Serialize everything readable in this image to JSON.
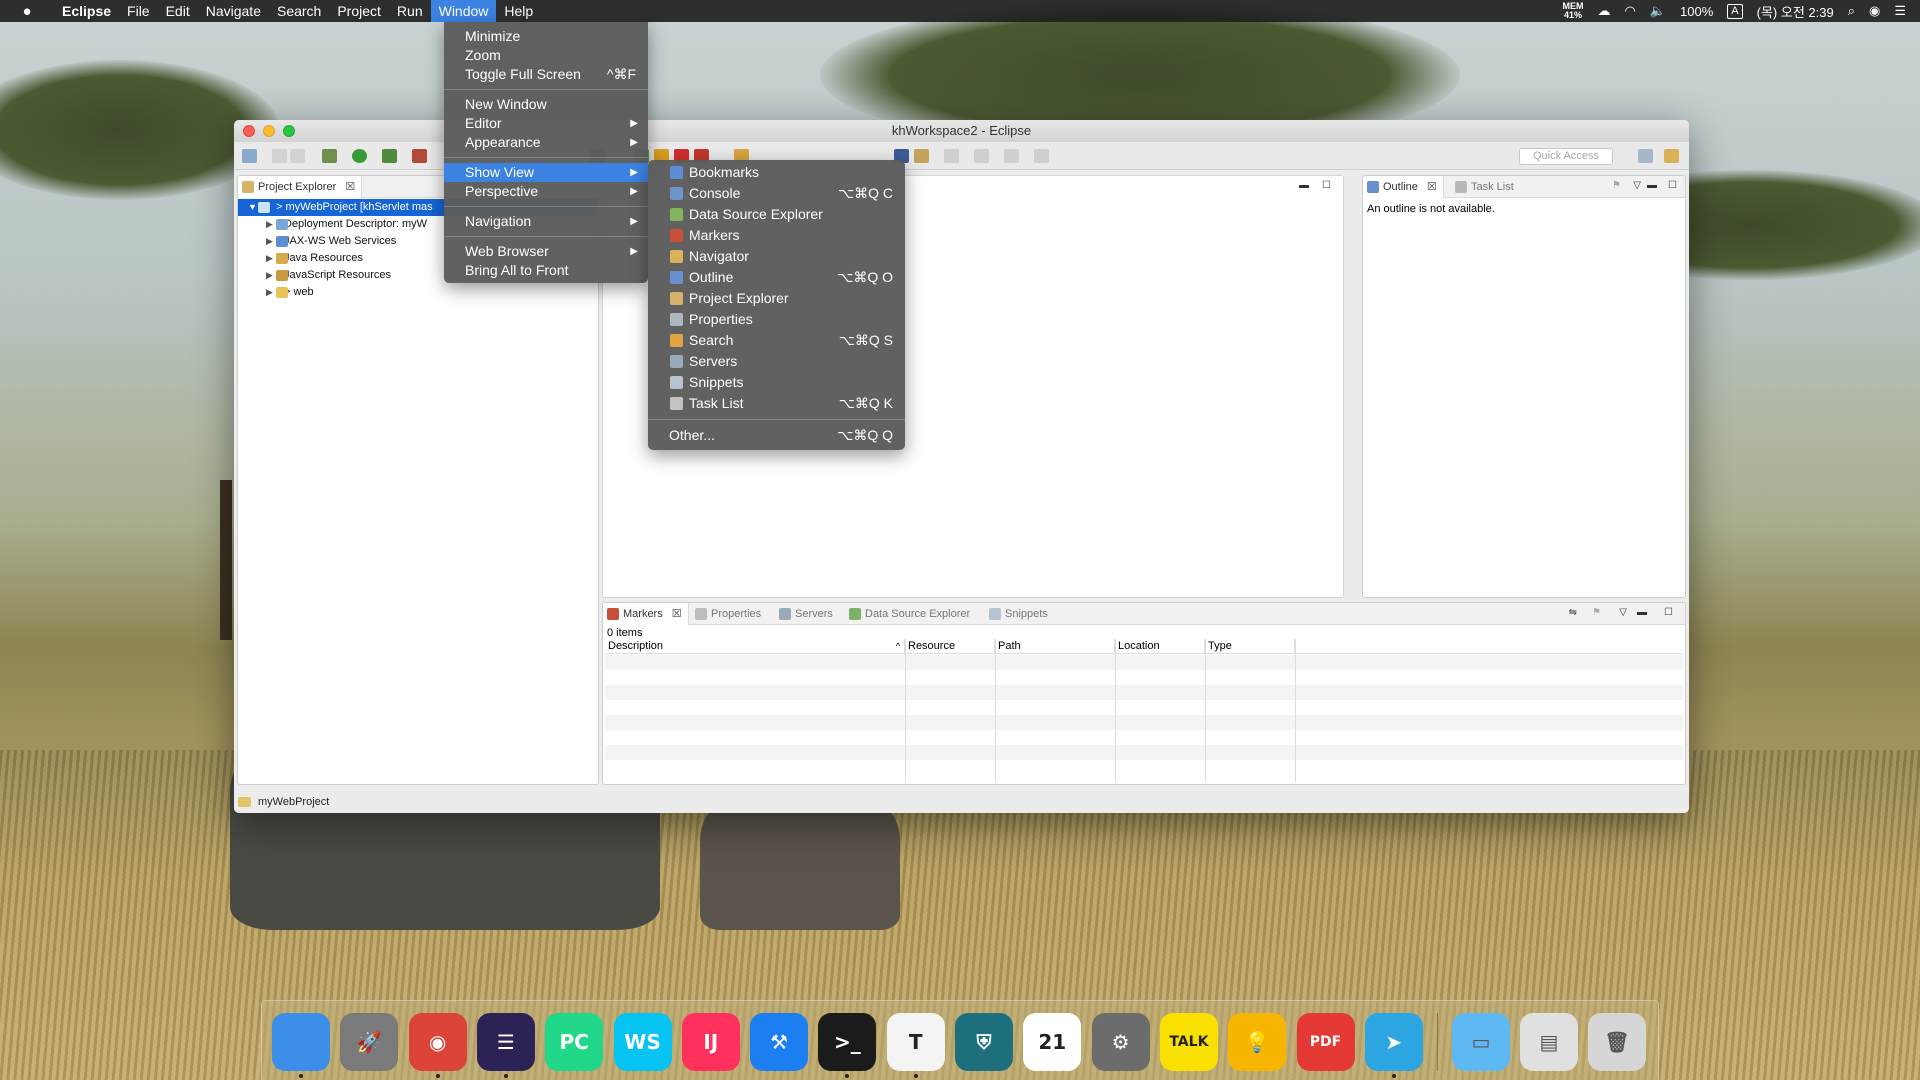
{
  "menubar": {
    "app": "Eclipse",
    "items": [
      "File",
      "Edit",
      "Navigate",
      "Search",
      "Project",
      "Run",
      "Window",
      "Help"
    ],
    "active": "Window",
    "status": {
      "mem_label": "MEM",
      "mem_value": "41%",
      "battery": "100%",
      "input": "A",
      "clock": "(목) 오전 2:39"
    }
  },
  "window": {
    "title": "khWorkspace2 - Eclipse",
    "quick_access_placeholder": "Quick Access",
    "status_text": "myWebProject"
  },
  "project_explorer": {
    "tab": "Project Explorer",
    "items": [
      {
        "label": "> myWebProject [khServlet mas",
        "selected": true
      },
      {
        "label": "Deployment Descriptor: myW"
      },
      {
        "label": "JAX-WS Web Services"
      },
      {
        "label": "Java Resources"
      },
      {
        "label": "JavaScript Resources"
      },
      {
        "label": "> web"
      }
    ]
  },
  "outline": {
    "tabs": [
      "Outline",
      "Task List"
    ],
    "message": "An outline is not available."
  },
  "bottom": {
    "tabs": [
      "Markers",
      "Properties",
      "Servers",
      "Data Source Explorer",
      "Snippets"
    ],
    "count": "0 items",
    "columns": [
      "Description",
      "Resource",
      "Path",
      "Location",
      "Type"
    ]
  },
  "window_menu": {
    "groups": [
      [
        {
          "label": "Minimize"
        },
        {
          "label": "Zoom"
        },
        {
          "label": "Toggle Full Screen",
          "shortcut": "^⌘F"
        }
      ],
      [
        {
          "label": "New Window"
        },
        {
          "label": "Editor",
          "submenu": true
        },
        {
          "label": "Appearance",
          "submenu": true
        }
      ],
      [
        {
          "label": "Show View",
          "submenu": true,
          "highlighted": true
        },
        {
          "label": "Perspective",
          "submenu": true
        }
      ],
      [
        {
          "label": "Navigation",
          "submenu": true
        }
      ],
      [
        {
          "label": "Web Browser",
          "submenu": true
        },
        {
          "label": "Bring All to Front"
        }
      ]
    ]
  },
  "show_view_menu": {
    "items": [
      {
        "label": "Bookmarks",
        "shortcut": ""
      },
      {
        "label": "Console",
        "shortcut": "⌥⌘Q C"
      },
      {
        "label": "Data Source Explorer",
        "shortcut": ""
      },
      {
        "label": "Markers",
        "shortcut": ""
      },
      {
        "label": "Navigator",
        "shortcut": ""
      },
      {
        "label": "Outline",
        "shortcut": "⌥⌘Q O"
      },
      {
        "label": "Project Explorer",
        "shortcut": ""
      },
      {
        "label": "Properties",
        "shortcut": ""
      },
      {
        "label": "Search",
        "shortcut": "⌥⌘Q S"
      },
      {
        "label": "Servers",
        "shortcut": ""
      },
      {
        "label": "Snippets",
        "shortcut": ""
      },
      {
        "label": "Task List",
        "shortcut": "⌥⌘Q K"
      }
    ],
    "other": {
      "label": "Other...",
      "shortcut": "⌥⌘Q Q"
    }
  },
  "dock": {
    "apps": [
      {
        "name": "Finder",
        "glyph": "",
        "color": "#3d8ee8",
        "running": true
      },
      {
        "name": "Launchpad",
        "glyph": "🚀",
        "color": "#7a7a7a",
        "running": false
      },
      {
        "name": "Chrome",
        "glyph": "◉",
        "color": "#db4437",
        "running": true
      },
      {
        "name": "Eclipse",
        "glyph": "☰",
        "color": "#2c2255",
        "running": true
      },
      {
        "name": "PyCharm",
        "glyph": "PC",
        "color": "#21d789",
        "running": false
      },
      {
        "name": "WebStorm",
        "glyph": "WS",
        "color": "#07c3f2",
        "running": false
      },
      {
        "name": "IntelliJ IDEA",
        "glyph": "IJ",
        "color": "#fe315d",
        "running": false
      },
      {
        "name": "Xcode",
        "glyph": "⚒",
        "color": "#1b7ff2",
        "running": false
      },
      {
        "name": "Terminal",
        "glyph": ">_",
        "color": "#1b1b1b",
        "running": true
      },
      {
        "name": "Typora",
        "glyph": "T",
        "color": "#f3f3f3",
        "running": true
      },
      {
        "name": "Shield",
        "glyph": "⛨",
        "color": "#1d6f7d",
        "running": false
      },
      {
        "name": "Calendar",
        "glyph": "21",
        "color": "#ffffff",
        "running": false
      },
      {
        "name": "System Preferences",
        "glyph": "⚙",
        "color": "#6c6c6c",
        "running": false
      },
      {
        "name": "KakaoTalk",
        "glyph": "TALK",
        "color": "#f9e000",
        "running": false
      },
      {
        "name": "Ideas",
        "glyph": "💡",
        "color": "#f7b500",
        "running": false
      },
      {
        "name": "PDF Expert",
        "glyph": "PDF",
        "color": "#e53935",
        "running": false
      },
      {
        "name": "Telegram",
        "glyph": "➤",
        "color": "#2ca5e0",
        "running": true
      }
    ],
    "stacks": [
      {
        "name": "Folder",
        "glyph": "▭",
        "color": "#5eb8f2"
      },
      {
        "name": "Downloads",
        "glyph": "▤",
        "color": "#e0e0e0"
      },
      {
        "name": "Trash",
        "glyph": "🗑",
        "color": "#d6d6d6"
      }
    ]
  }
}
